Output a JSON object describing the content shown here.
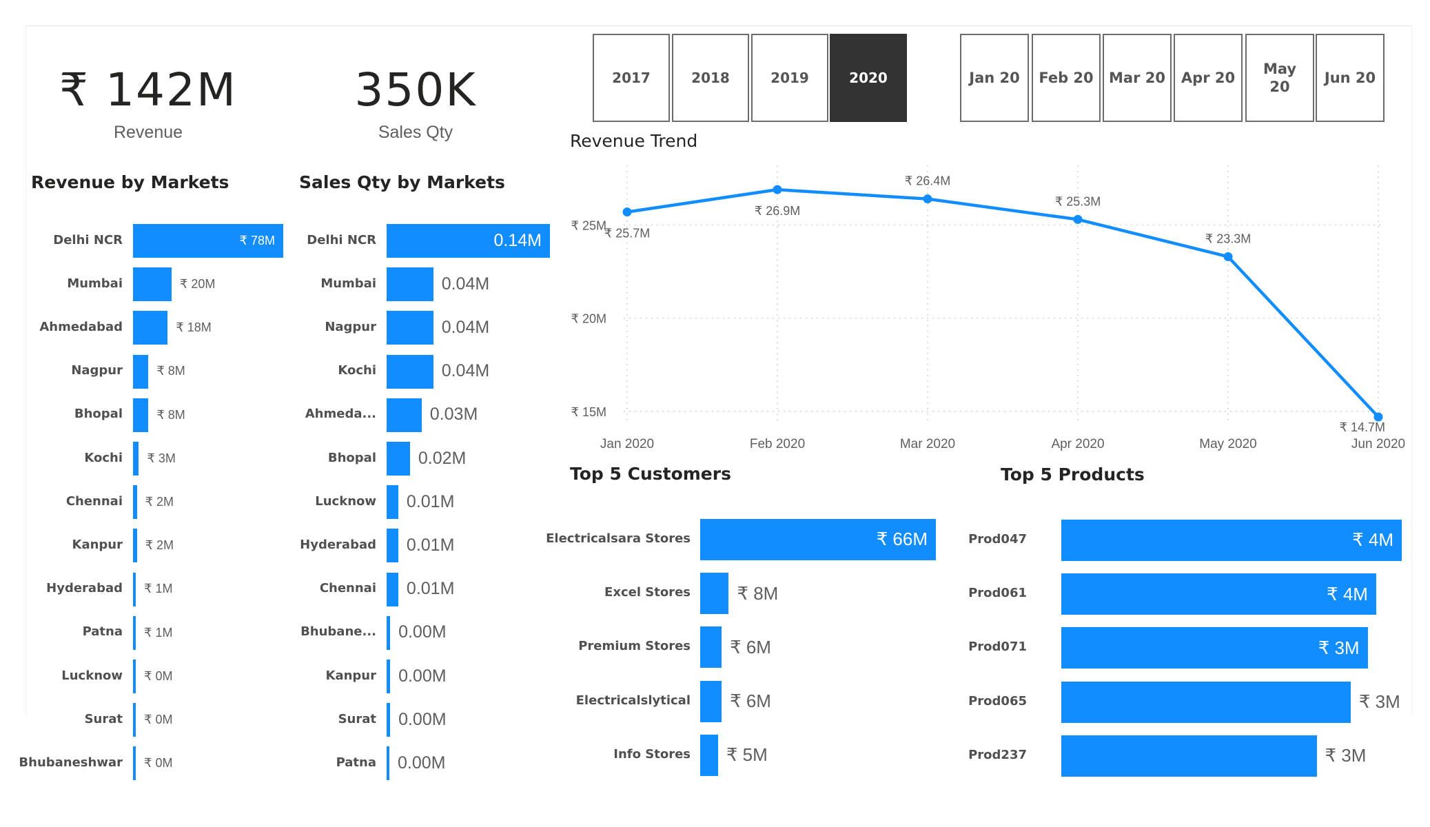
{
  "kpis": {
    "revenue_value": "₹ 142M",
    "revenue_label": "Revenue",
    "qty_value": "350K",
    "qty_label": "Sales Qty"
  },
  "year_slicer": {
    "items": [
      "2017",
      "2018",
      "2019",
      "2020"
    ],
    "selected": "2020"
  },
  "month_slicer": {
    "items": [
      "Jan 20",
      "Feb 20",
      "Mar 20",
      "Apr 20",
      "May 20",
      "Jun 20"
    ]
  },
  "titles": {
    "revenue_by_markets": "Revenue by Markets",
    "qty_by_markets": "Sales Qty by Markets",
    "revenue_trend": "Revenue Trend",
    "top_customers": "Top 5 Customers",
    "top_products": "Top 5 Products"
  },
  "colors": {
    "bar": "#118dff",
    "line": "#118dff",
    "selected_slicer": "#333333"
  },
  "chart_data": [
    {
      "id": "revenue_by_markets",
      "type": "bar",
      "orientation": "horizontal",
      "title": "Revenue by Markets",
      "categories": [
        "Delhi NCR",
        "Mumbai",
        "Ahmedabad",
        "Nagpur",
        "Bhopal",
        "Kochi",
        "Chennai",
        "Kanpur",
        "Hyderabad",
        "Patna",
        "Lucknow",
        "Surat",
        "Bhubaneshwar"
      ],
      "values": [
        78,
        20,
        18,
        8,
        8,
        3,
        2,
        2,
        1,
        1,
        0.4,
        0.3,
        0.2
      ],
      "labels": [
        "₹ 78M",
        "₹ 20M",
        "₹ 18M",
        "₹ 8M",
        "₹ 8M",
        "₹ 3M",
        "₹ 2M",
        "₹ 2M",
        "₹ 1M",
        "₹ 1M",
        "₹ 0M",
        "₹ 0M",
        "₹ 0M"
      ],
      "max": 78
    },
    {
      "id": "qty_by_markets",
      "type": "bar",
      "orientation": "horizontal",
      "title": "Sales Qty by Markets",
      "categories": [
        "Delhi NCR",
        "Mumbai",
        "Nagpur",
        "Kochi",
        "Ahmeda...",
        "Bhopal",
        "Lucknow",
        "Hyderabad",
        "Chennai",
        "Bhubane...",
        "Kanpur",
        "Surat",
        "Patna"
      ],
      "values": [
        0.14,
        0.04,
        0.04,
        0.04,
        0.03,
        0.02,
        0.01,
        0.01,
        0.01,
        0.003,
        0.003,
        0.003,
        0.002
      ],
      "labels": [
        "0.14M",
        "0.04M",
        "0.04M",
        "0.04M",
        "0.03M",
        "0.02M",
        "0.01M",
        "0.01M",
        "0.01M",
        "0.00M",
        "0.00M",
        "0.00M",
        "0.00M"
      ],
      "max": 0.14
    },
    {
      "id": "revenue_trend",
      "type": "line",
      "title": "Revenue Trend",
      "x": [
        "Jan 2020",
        "Feb 2020",
        "Mar 2020",
        "Apr 2020",
        "May 2020",
        "Jun 2020"
      ],
      "values": [
        25.7,
        26.9,
        26.4,
        25.3,
        23.3,
        14.7
      ],
      "labels": [
        "₹ 25.7M",
        "₹ 26.9M",
        "₹ 26.4M",
        "₹ 25.3M",
        "₹ 23.3M",
        "₹ 14.7M"
      ],
      "label_position": [
        "below",
        "below",
        "above",
        "above",
        "above",
        "below"
      ],
      "y_ticks": [
        15,
        20,
        25
      ],
      "y_tick_labels": [
        "₹ 15M",
        "₹ 20M",
        "₹ 25M"
      ],
      "ylim": [
        14.7,
        28.2
      ],
      "grid": true
    },
    {
      "id": "top_customers",
      "type": "bar",
      "orientation": "horizontal",
      "title": "Top 5 Customers",
      "categories": [
        "Electricalsara Stores",
        "Excel Stores",
        "Premium Stores",
        "Electricalslytical",
        "Info Stores"
      ],
      "values": [
        66,
        8,
        6,
        6,
        5
      ],
      "labels": [
        "₹ 66M",
        "₹ 8M",
        "₹ 6M",
        "₹ 6M",
        "₹ 5M"
      ],
      "max": 66
    },
    {
      "id": "top_products",
      "type": "bar",
      "orientation": "horizontal",
      "title": "Top 5 Products",
      "categories": [
        "Prod047",
        "Prod061",
        "Prod071",
        "Prod065",
        "Prod237"
      ],
      "values": [
        4.0,
        3.7,
        3.6,
        3.4,
        3.0
      ],
      "labels": [
        "₹ 4M",
        "₹ 4M",
        "₹ 3M",
        "₹ 3M",
        "₹ 3M"
      ],
      "max": 4.0
    }
  ]
}
